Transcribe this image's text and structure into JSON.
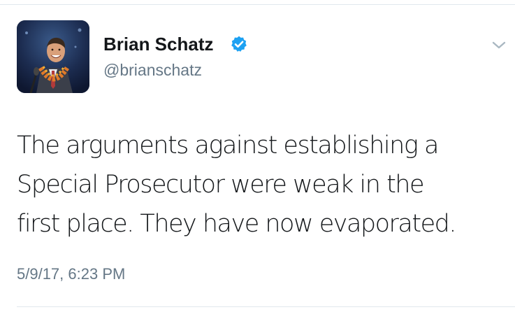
{
  "tweet": {
    "display_name": "Brian Schatz",
    "handle": "@brianschatz",
    "text_lines": [
      "The arguments against establishing a",
      "Special Prosecutor were weak in the",
      "first place. They have now evaporated."
    ],
    "timestamp": "5/9/17, 6:23 PM"
  },
  "icons": {
    "verified": "verified-badge-icon",
    "menu": "chevron-down-icon"
  },
  "colors": {
    "verified_blue": "#1da1f2",
    "secondary_text": "#657786",
    "primary_text": "#14171a",
    "divider": "#e1e8ed"
  }
}
